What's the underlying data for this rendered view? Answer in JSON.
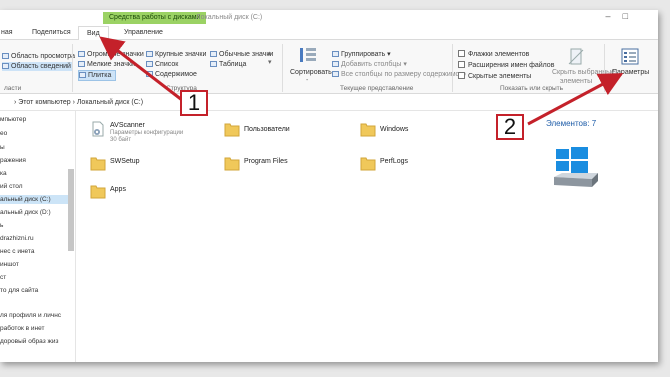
{
  "title_bar": {
    "context_tab": "Средства работы с дисками",
    "window_title": "Локальный диск (C:)"
  },
  "tabs": [
    {
      "label": "ная"
    },
    {
      "label": "Поделиться"
    },
    {
      "label": "Вид"
    },
    {
      "label": "Управление"
    }
  ],
  "ribbon": {
    "panes_group": {
      "preview_label": "Область просмотра",
      "details_label": "Область сведений",
      "group_label": "ласти"
    },
    "layout_group": {
      "items": [
        "Огромные значки",
        "Крупные значки",
        "Обычные значки",
        "Мелкие значки",
        "Список",
        "Таблица",
        "Плитка",
        "Содержимое"
      ],
      "group_label": "Структура"
    },
    "current_view_group": {
      "sort_label": "Сортировать",
      "sort_label2": "-",
      "group_by": "Группировать",
      "add_columns": "Добавить столбцы",
      "size_columns": "Все столбцы по размеру содержимого",
      "group_label": "Текущее представление"
    },
    "show_hide_group": {
      "item_checkboxes": "Флажки элементов",
      "file_extensions": "Расширения имен файлов",
      "hidden_items": "Скрытые элементы",
      "hide_selected_1": "Скрыть выбранные",
      "hide_selected_2": "элементы",
      "group_label": "Показать или скрыть"
    },
    "options": {
      "label": "Параметры"
    }
  },
  "address_bar": {
    "path": "›  Этот компьютер  ›  Локальный диск (C:)"
  },
  "nav_pane": {
    "items": [
      "мпьютер",
      "ео",
      "ы",
      "ражения",
      "ка",
      "ий стол",
      "альный диск (C:)",
      "альный диск (D:)",
      "ь",
      "drazhizni.ru",
      "нес с инета",
      "иншот",
      "ст",
      "то для сайта",
      "ля профиля и личнс",
      "работок в инет",
      "доровый образ жиз"
    ]
  },
  "files": [
    {
      "name": "AVScanner",
      "sub1": "Параметры конфигурации",
      "sub2": "30 байт",
      "icon": "config-file-icon"
    },
    {
      "name": "Пользователи",
      "icon": "folder-icon"
    },
    {
      "name": "Windows",
      "icon": "folder-icon"
    },
    {
      "name": "SWSetup",
      "icon": "folder-icon"
    },
    {
      "name": "Program Files",
      "icon": "folder-icon"
    },
    {
      "name": "PerfLogs",
      "icon": "folder-icon"
    },
    {
      "name": "Apps",
      "icon": "folder-icon"
    }
  ],
  "details_pane": {
    "count": "Элементов: 7"
  },
  "annotations": {
    "one": "1",
    "two": "2"
  },
  "colors": {
    "context_tab": "#9bd264",
    "selection": "#cce4f7",
    "annotation_red": "#c4212a",
    "folder": "#f0c85a"
  }
}
